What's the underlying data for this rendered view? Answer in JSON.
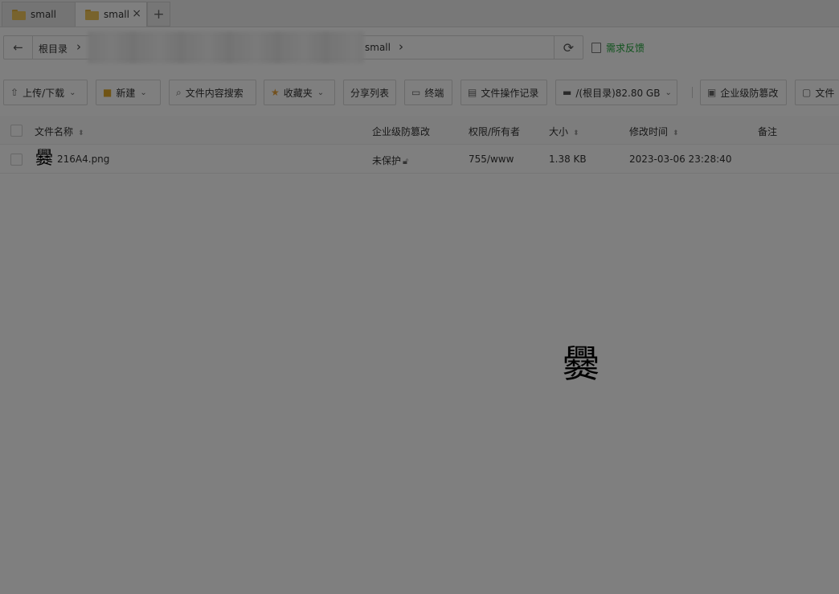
{
  "tabs": [
    {
      "label": "small",
      "active": false
    },
    {
      "label": "small",
      "active": true
    }
  ],
  "tab_add_label": "+",
  "tab_close_label": "×",
  "address": {
    "back_icon": "←",
    "root_label": "根目录",
    "chevron": "›",
    "current_label": "small",
    "refresh_icon": "⟳"
  },
  "feedback_label": "需求反馈",
  "toolbar": {
    "upload_label": "上传/下载",
    "new_label": "新建",
    "search_content_label": "文件内容搜索",
    "favorites_label": "收藏夹",
    "share_list_label": "分享列表",
    "terminal_label": "终端",
    "op_log_label": "文件操作记录",
    "disk_label": "/(根目录)82.80 GB",
    "tamper_label": "企业级防篡改",
    "file_label": "文件"
  },
  "table": {
    "headers": {
      "name": "文件名称",
      "tamper": "企业级防篡改",
      "perm": "权限/所有者",
      "size": "大小",
      "mtime": "修改时间",
      "remark": "备注"
    },
    "rows": [
      {
        "thumb": "爨",
        "name": "216A4.png",
        "tamper": "未保护",
        "perm": "755/www",
        "size": "1.38 KB",
        "mtime": "2023-03-06 23:28:40",
        "remark": ""
      }
    ]
  },
  "preview": {
    "glyph": "爨"
  },
  "colors": {
    "accent_green": "#20a53a",
    "overlay": "rgba(0,0,0,0.5)",
    "folder": "#f1c75a"
  }
}
